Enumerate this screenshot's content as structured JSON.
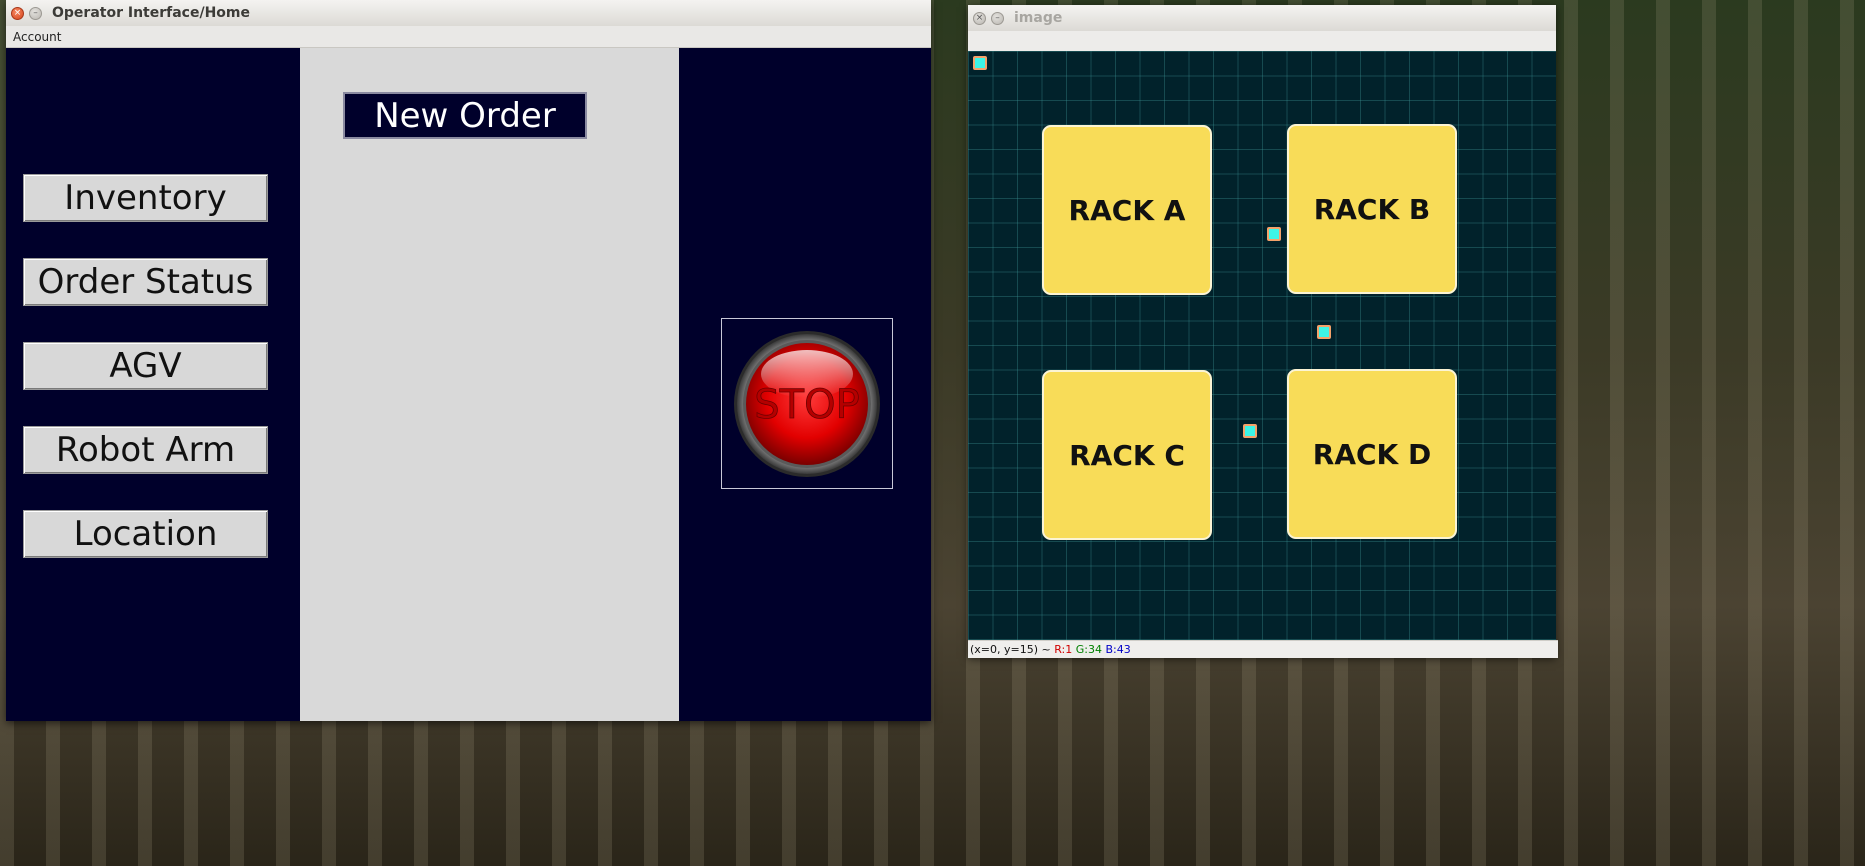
{
  "operator_window": {
    "title": "Operator Interface/Home",
    "menu": {
      "account_label": "Account"
    },
    "new_order_label": "New Order",
    "nav_buttons": [
      {
        "label": "Inventory"
      },
      {
        "label": "Order Status"
      },
      {
        "label": "AGV"
      },
      {
        "label": "Robot Arm"
      },
      {
        "label": "Location"
      }
    ],
    "stop_label": "STOP",
    "colors": {
      "panel_dark": "#00002b",
      "panel_light": "#d9d9d9",
      "stop_red": "#e00000"
    }
  },
  "image_window": {
    "title": "image",
    "racks": [
      {
        "label": "RACK A"
      },
      {
        "label": "RACK B"
      },
      {
        "label": "RACK C"
      },
      {
        "label": "RACK D"
      }
    ],
    "status": {
      "coords": "(x=0, y=15) ~",
      "r": "R:1",
      "g": "G:34",
      "b": "B:43"
    },
    "colors": {
      "canvas_bg": "#01222b",
      "rack_fill": "#f8dc58",
      "agv_fill": "#3df5e6"
    }
  }
}
